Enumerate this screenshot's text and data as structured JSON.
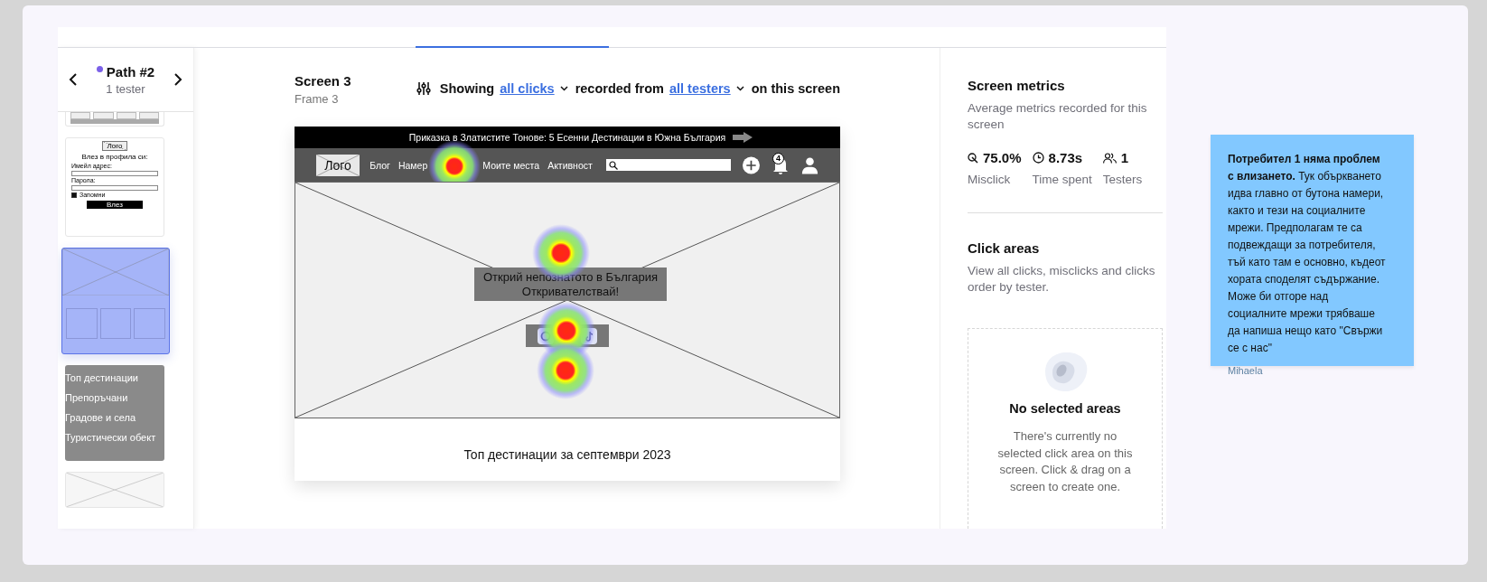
{
  "path_nav": {
    "title": "Path #2",
    "subtitle": "1 tester",
    "color": "#7b61e8"
  },
  "thumbnails": [
    {
      "kind": "cards",
      "selected": false
    },
    {
      "kind": "login",
      "selected": false,
      "logo": "Лого",
      "heading": "Влез в профила си:",
      "fields": [
        "Имейл адрес:",
        "Парола:"
      ],
      "remember": {
        "label": "Запомни",
        "checked": true
      },
      "button": "Влез"
    },
    {
      "kind": "home",
      "selected": true
    },
    {
      "kind": "menu",
      "selected": false,
      "items": [
        "Топ дестинации",
        "Препоръчани",
        "Градове и села",
        "Туристически обект"
      ]
    },
    {
      "kind": "blank",
      "selected": false
    }
  ],
  "screen": {
    "title": "Screen 3",
    "subtitle": "Frame 3"
  },
  "filter": {
    "prefix": "Showing",
    "clicks": "all clicks",
    "middle": "recorded from",
    "testers": "all testers",
    "suffix": "on this screen"
  },
  "prototype": {
    "banner": "Приказка в Златистите Тонове: 5 Есенни Дестинации в Южна България",
    "logo": "Лого",
    "nav_links": [
      "Блог",
      "Намер",
      "Моите места",
      "Активност"
    ],
    "notification_count": "4",
    "hero_lines": [
      "Открий непознатото в България",
      "Откривателствай!"
    ],
    "section_title": "Топ дестинации за септември 2023"
  },
  "metrics": {
    "title": "Screen metrics",
    "description": "Average metrics recorded for this screen",
    "items": [
      {
        "kind": "misclick",
        "value": "75.0%",
        "label": "Misclick"
      },
      {
        "kind": "time",
        "value": "8.73s",
        "label": "Time spent"
      },
      {
        "kind": "testers",
        "value": "1",
        "label": "Testers"
      }
    ]
  },
  "click_areas": {
    "title": "Click areas",
    "description": "View all clicks, misclicks and clicks order by tester.",
    "empty_title": "No selected areas",
    "empty_text": "There's currently no selected click area on this screen. Click & drag on a screen to create one."
  },
  "note": {
    "text": "**Потребител 1 няма проблем с влизането.** Тук объркването идва главно от бутона намери, както и тези на социалните мрежи. Предполагам те са подвеждащи за потребителя, тъй като там е основно, къдеот хората споделят съдържание. Може би отгоре над социалните мрежи трябваше да напиша нещо като \"Свържи се с нас\"",
    "author": "Mihaela"
  }
}
